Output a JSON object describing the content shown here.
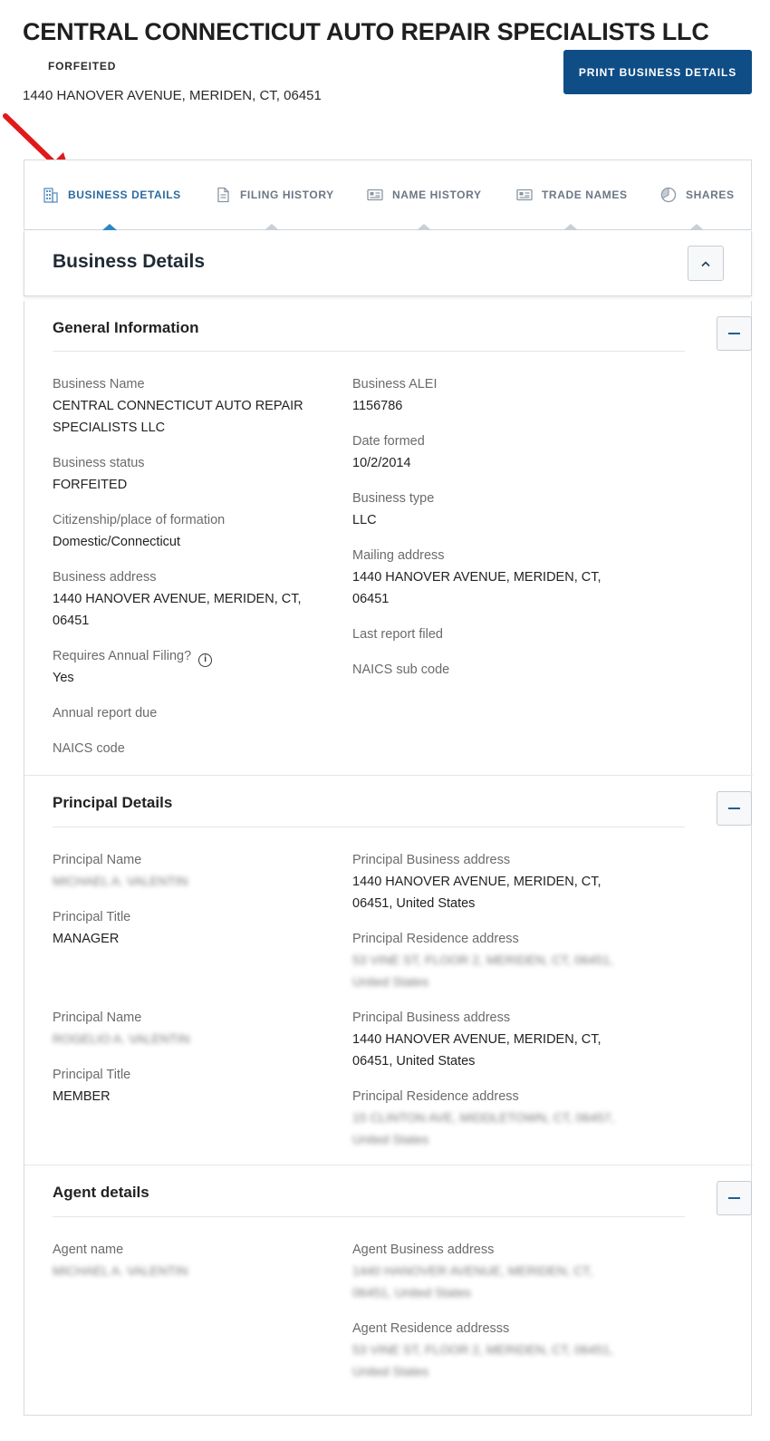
{
  "header": {
    "title": "CENTRAL CONNECTICUT AUTO REPAIR SPECIALISTS LLC",
    "status": "FORFEITED",
    "address": "1440 HANOVER AVENUE, MERIDEN, CT, 06451",
    "print_button": "PRINT BUSINESS DETAILS"
  },
  "tabs": [
    {
      "label": "BUSINESS DETAILS",
      "icon": "building-icon",
      "active": true
    },
    {
      "label": "FILING HISTORY",
      "icon": "document-icon",
      "active": false
    },
    {
      "label": "NAME HISTORY",
      "icon": "id-card-icon",
      "active": false
    },
    {
      "label": "TRADE NAMES",
      "icon": "id-card-icon",
      "active": false
    },
    {
      "label": "SHARES",
      "icon": "pie-chart-icon",
      "active": false
    }
  ],
  "section": {
    "title": "Business Details"
  },
  "general": {
    "title": "General Information",
    "business_name_label": "Business Name",
    "business_name_line1": "CENTRAL CONNECTICUT AUTO REPAIR",
    "business_name_line2": "SPECIALISTS LLC",
    "business_status_label": "Business status",
    "business_status": "FORFEITED",
    "citizenship_label": "Citizenship/place of formation",
    "citizenship": "Domestic/Connecticut",
    "business_address_label": "Business address",
    "business_address_line1": "1440 HANOVER AVENUE, MERIDEN, CT,",
    "business_address_line2": "06451",
    "requires_annual_label": "Requires Annual Filing?",
    "requires_annual": "Yes",
    "annual_report_due_label": "Annual report due",
    "naics_code_label": "NAICS code",
    "alei_label": "Business ALEI",
    "alei": "1156786",
    "date_formed_label": "Date formed",
    "date_formed": "10/2/2014",
    "business_type_label": "Business type",
    "business_type": "LLC",
    "mailing_address_label": "Mailing address",
    "mailing_address_line1": "1440 HANOVER AVENUE, MERIDEN, CT,",
    "mailing_address_line2": "06451",
    "last_report_label": "Last report filed",
    "naics_sub_label": "NAICS sub code"
  },
  "principals": {
    "title": "Principal Details",
    "items": [
      {
        "name_label": "Principal Name",
        "name": "MICHAEL A. VALENTIN",
        "title_label": "Principal Title",
        "title": "MANAGER",
        "business_address_label": "Principal Business address",
        "business_address_line1": "1440 HANOVER AVENUE, MERIDEN, CT,",
        "business_address_line2": "06451, United States",
        "residence_label": "Principal Residence address",
        "residence_line1": "53 VINE ST, FLOOR 2, MERIDEN, CT, 06451,",
        "residence_line2": "United States"
      },
      {
        "name_label": "Principal Name",
        "name": "ROGELIO A. VALENTIN",
        "title_label": "Principal Title",
        "title": "MEMBER",
        "business_address_label": "Principal Business address",
        "business_address_line1": "1440 HANOVER AVENUE, MERIDEN, CT,",
        "business_address_line2": "06451, United States",
        "residence_label": "Principal Residence address",
        "residence_line1": "15 CLINTON AVE, MIDDLETOWN, CT, 06457,",
        "residence_line2": "United States"
      }
    ]
  },
  "agent": {
    "title": "Agent details",
    "name_label": "Agent name",
    "name": "MICHAEL A. VALENTIN",
    "business_address_label": "Agent Business address",
    "business_address_line1": "1440 HANOVER AVENUE, MERIDEN, CT,",
    "business_address_line2": "06451, United States",
    "residence_label": "Agent Residence addresss",
    "residence_line1": "53 VINE ST, FLOOR 2, MERIDEN, CT, 06451,",
    "residence_line2": "United States"
  },
  "colors": {
    "primary": "#0f4d86",
    "tab_active": "#2d6a9f",
    "arrow": "#e0191b"
  }
}
